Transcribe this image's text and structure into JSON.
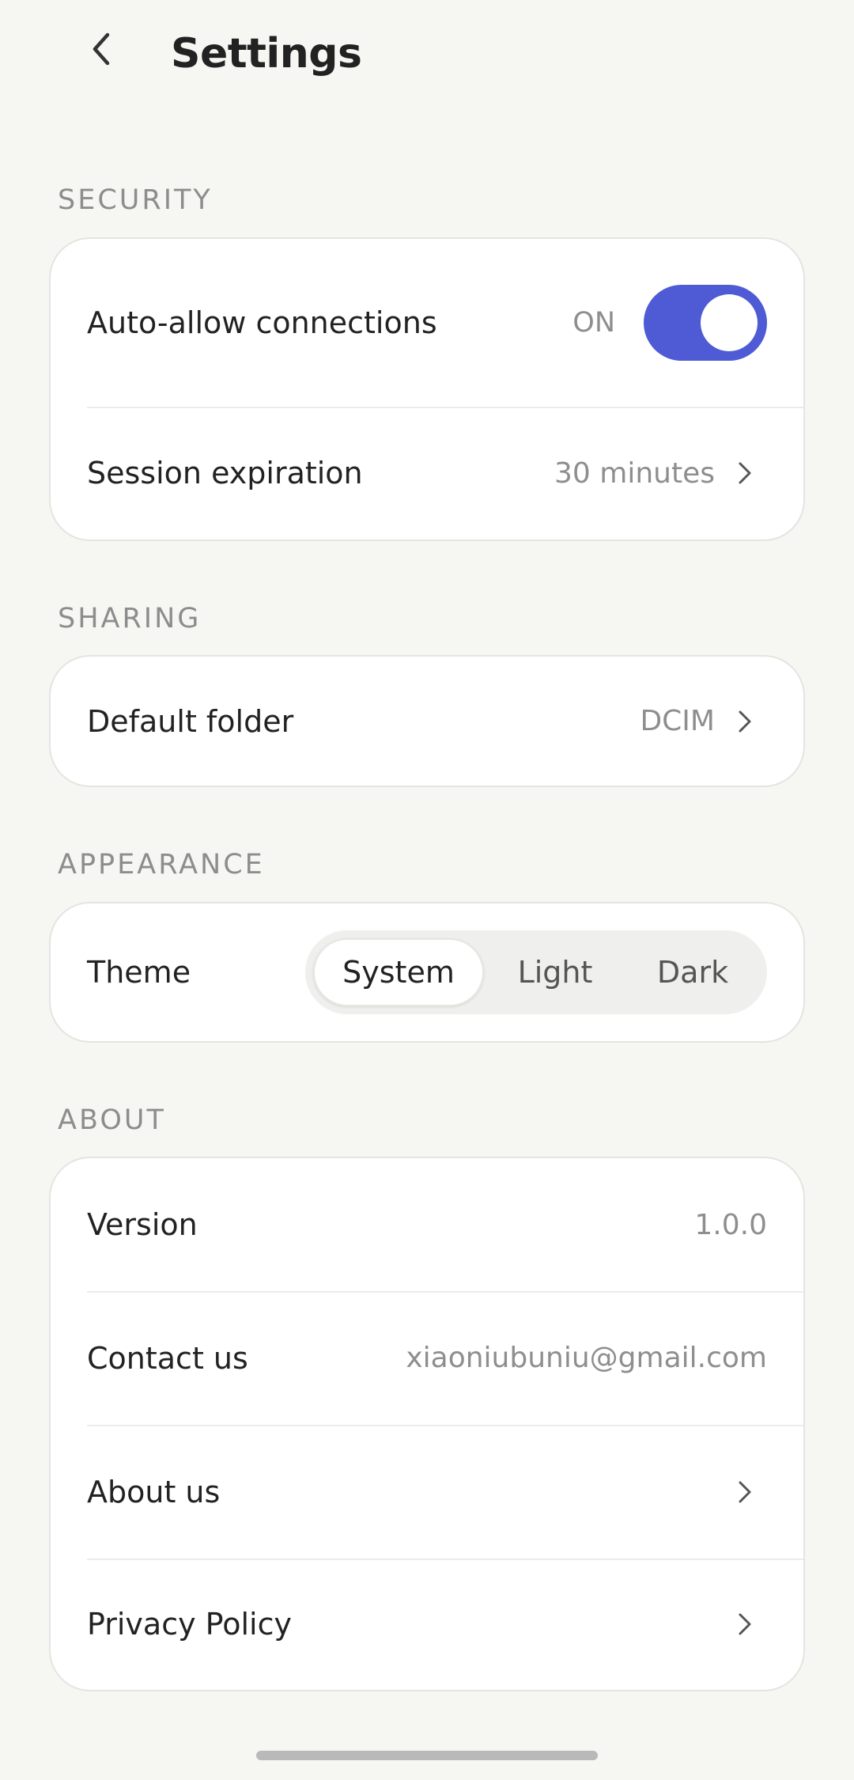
{
  "header": {
    "title": "Settings"
  },
  "sections": {
    "security": {
      "label": "SECURITY",
      "auto_allow": {
        "label": "Auto-allow connections",
        "state_text": "ON",
        "enabled": true
      },
      "session_expiration": {
        "label": "Session expiration",
        "value": "30 minutes"
      }
    },
    "sharing": {
      "label": "SHARING",
      "default_folder": {
        "label": "Default folder",
        "value": "DCIM"
      }
    },
    "appearance": {
      "label": "APPEARANCE",
      "theme": {
        "label": "Theme",
        "options": [
          "System",
          "Light",
          "Dark"
        ],
        "selected": "System"
      }
    },
    "about": {
      "label": "ABOUT",
      "version": {
        "label": "Version",
        "value": "1.0.0"
      },
      "contact": {
        "label": "Contact us",
        "value": "xiaoniubuniu@gmail.com"
      },
      "about_us": {
        "label": "About us"
      },
      "privacy": {
        "label": "Privacy Policy"
      }
    }
  },
  "colors": {
    "accent": "#4e5bd4",
    "background": "#f6f6f3",
    "card": "#ffffff",
    "muted_text": "#8e8e8e"
  },
  "icons": {
    "back": "chevron-left-icon",
    "row_chevron": "chevron-right-icon"
  }
}
